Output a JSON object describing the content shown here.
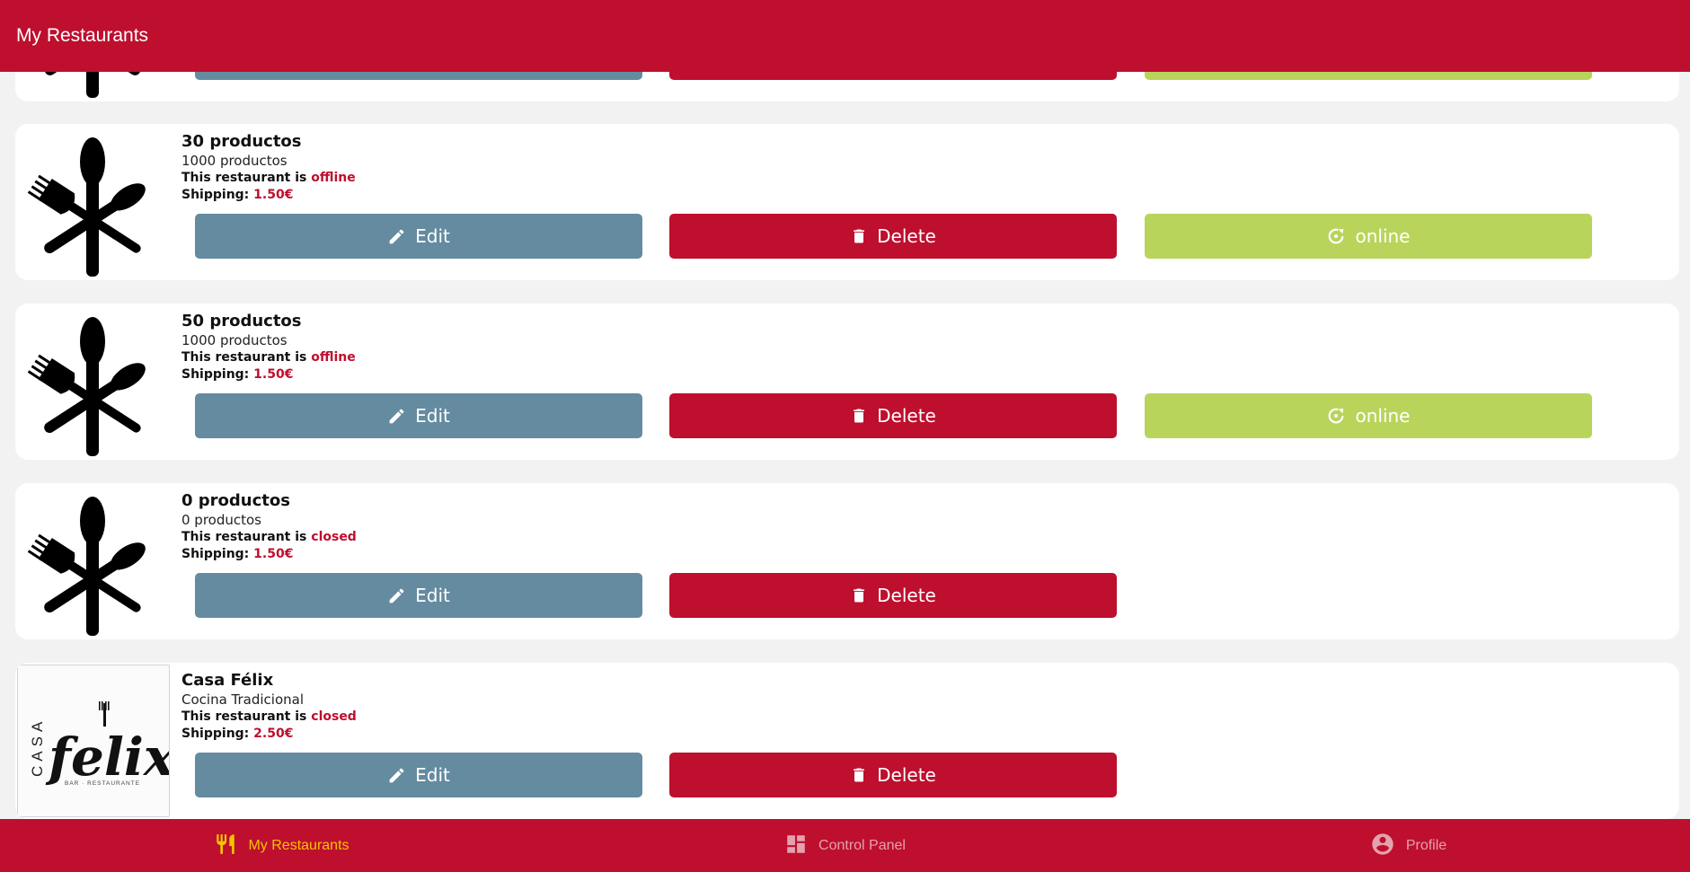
{
  "header": {
    "title": "My Restaurants"
  },
  "restaurants": [
    {
      "name": "30 productos",
      "description": "1000 productos",
      "status_prefix": "This restaurant is",
      "status": "offline",
      "shipping_label": "Shipping:",
      "shipping": "1.50€",
      "logo": "cutlery",
      "edit_label": "Edit",
      "delete_label": "Delete",
      "online_label": "online"
    },
    {
      "name": "50 productos",
      "description": "1000 productos",
      "status_prefix": "This restaurant is",
      "status": "offline",
      "shipping_label": "Shipping:",
      "shipping": "1.50€",
      "logo": "cutlery",
      "edit_label": "Edit",
      "delete_label": "Delete",
      "online_label": "online"
    },
    {
      "name": "0 productos",
      "description": "0 productos",
      "status_prefix": "This restaurant is",
      "status": "closed",
      "shipping_label": "Shipping:",
      "shipping": "1.50€",
      "logo": "cutlery",
      "edit_label": "Edit",
      "delete_label": "Delete"
    },
    {
      "name": "Casa Félix",
      "description": "Cocina Tradicional",
      "status_prefix": "This restaurant is",
      "status": "closed",
      "shipping_label": "Shipping:",
      "shipping": "2.50€",
      "logo": "casa-felix-logo",
      "logo_text": {
        "casa": "CASA",
        "felix": "felix",
        "tagline": "BAR · RESTAURANTE"
      },
      "edit_label": "Edit",
      "delete_label": "Delete"
    }
  ],
  "bottom_nav": [
    {
      "label": "My Restaurants",
      "icon": "restaurant-icon",
      "active": true
    },
    {
      "label": "Control Panel",
      "icon": "dashboard-icon",
      "active": false
    },
    {
      "label": "Profile",
      "icon": "account-circle-icon",
      "active": false
    }
  ],
  "colors": {
    "primary": "#be0f2e",
    "edit": "#648ba0",
    "online": "#b9d45b",
    "active_nav": "#f3c400",
    "background": "#f2f2f2"
  }
}
